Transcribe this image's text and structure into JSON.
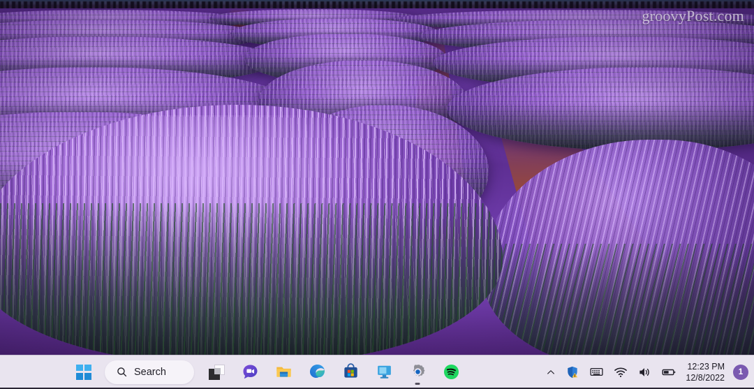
{
  "desktop": {
    "wallpaper_description": "Lavender field rows receding to horizon",
    "watermark": "groovyPost.com",
    "colors": {
      "lavender_light": "#ba8ee8",
      "lavender_mid": "#7a46bb",
      "lavender_dark": "#3e2068",
      "soil_red": "#9a4a32",
      "stem_green": "#265428"
    }
  },
  "taskbar": {
    "background_color": "#e9e4ef",
    "start": {
      "name": "Start",
      "icon": "windows-logo-icon"
    },
    "search": {
      "label": "Search",
      "placeholder": "Search",
      "icon": "search-icon"
    },
    "pinned": [
      {
        "id": "task-view",
        "label": "Task View",
        "icon": "task-view-icon",
        "active": false
      },
      {
        "id": "chat",
        "label": "Chat",
        "icon": "teams-chat-icon",
        "active": false
      },
      {
        "id": "file-explorer",
        "label": "File Explorer",
        "icon": "file-explorer-icon",
        "active": false
      },
      {
        "id": "edge",
        "label": "Microsoft Edge",
        "icon": "edge-icon",
        "active": false
      },
      {
        "id": "microsoft-store",
        "label": "Microsoft Store",
        "icon": "microsoft-store-icon",
        "active": false
      },
      {
        "id": "remote-desktop",
        "label": "Remote Desktop",
        "icon": "remote-desktop-icon",
        "active": false
      },
      {
        "id": "settings",
        "label": "Settings",
        "icon": "settings-gear-icon",
        "active": true
      },
      {
        "id": "spotify",
        "label": "Spotify",
        "icon": "spotify-icon",
        "active": false
      }
    ],
    "tray": {
      "overflow": {
        "label": "Show hidden icons",
        "icon": "chevron-up-icon"
      },
      "items": [
        {
          "id": "defender",
          "label": "Windows Security - action needed",
          "icon": "shield-warning-icon"
        },
        {
          "id": "keyboard",
          "label": "Touch keyboard",
          "icon": "touch-keyboard-icon"
        },
        {
          "id": "network",
          "label": "Network - Internet access",
          "icon": "wifi-icon"
        },
        {
          "id": "volume",
          "label": "Volume",
          "icon": "speaker-icon"
        },
        {
          "id": "battery",
          "label": "Battery",
          "icon": "battery-icon"
        }
      ],
      "clock": {
        "time": "12:23 PM",
        "date": "12/8/2022"
      },
      "notifications": {
        "count": "1",
        "badge_color": "#7a59b0"
      }
    }
  }
}
